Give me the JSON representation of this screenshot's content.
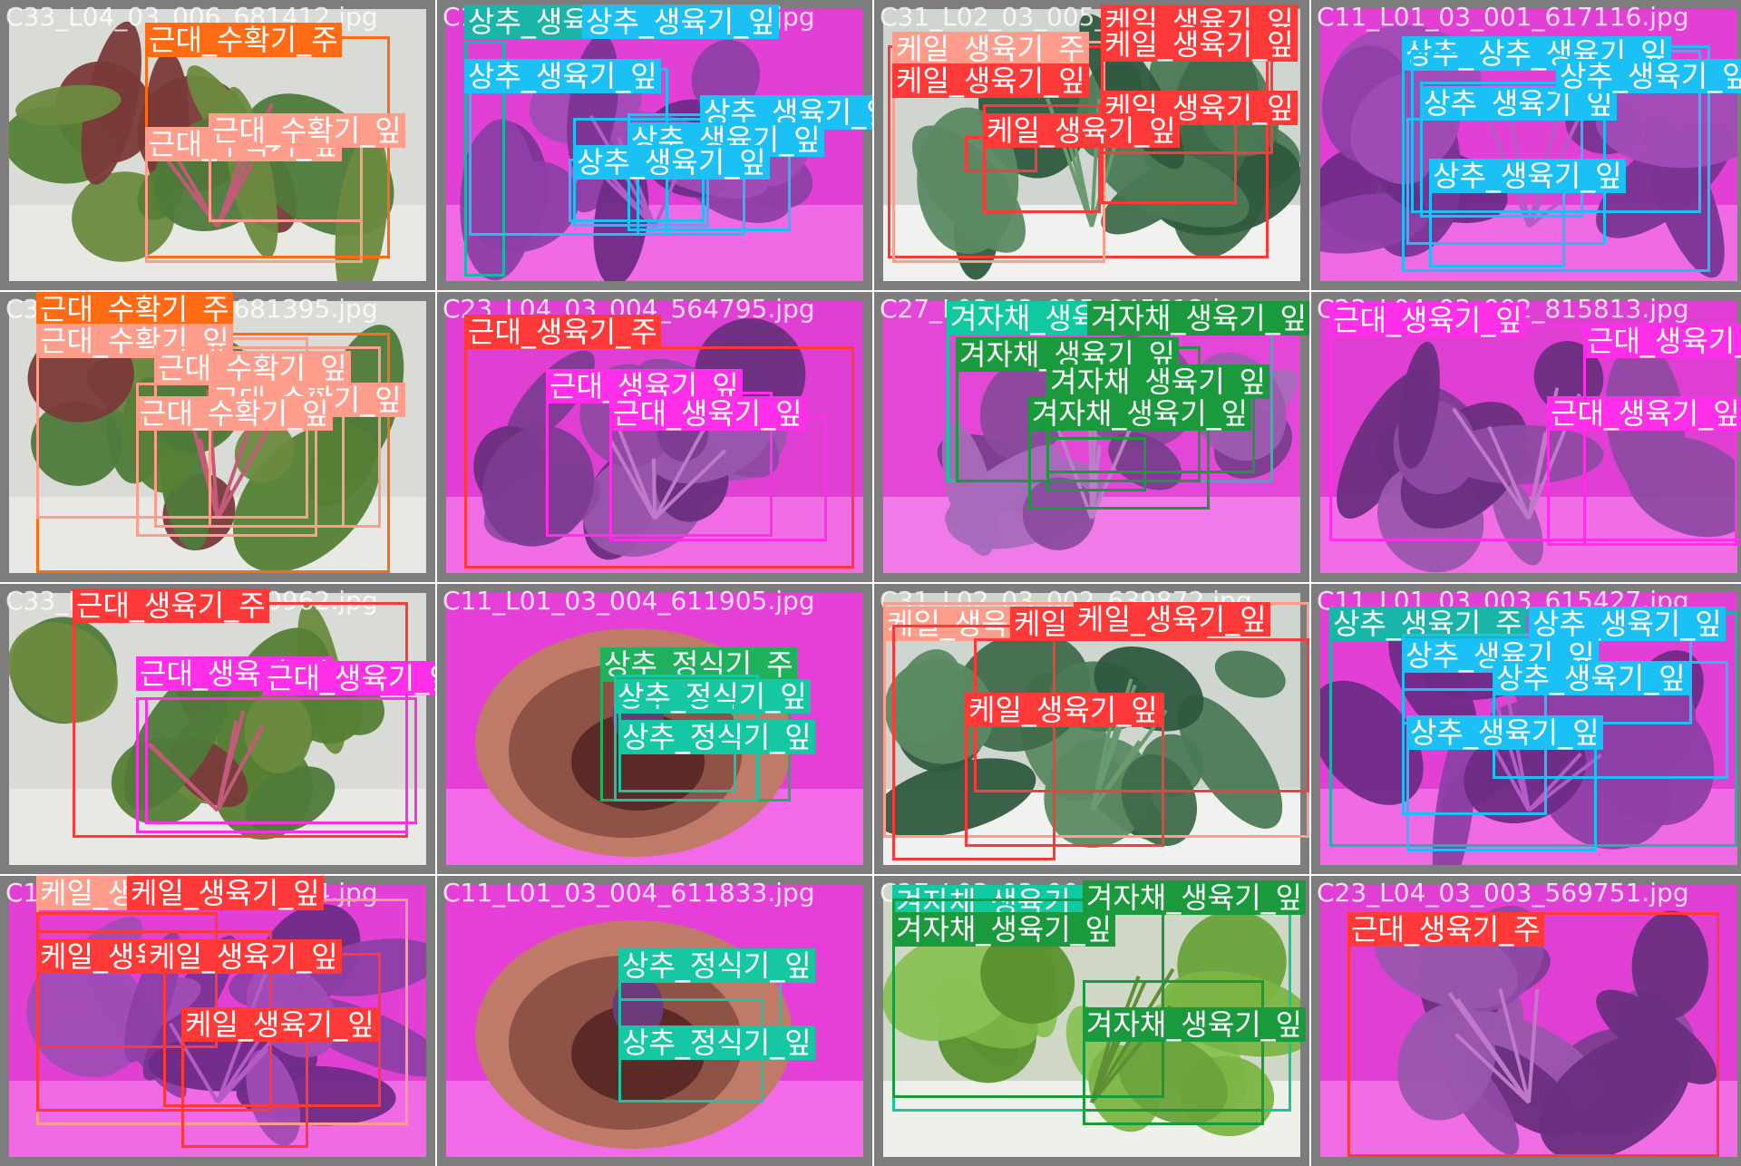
{
  "colors": {
    "근대_수확기_주": "#ff6a14",
    "근대_수확기_잎": "#ff9d8c",
    "근대_생육기_주": "#ff3838",
    "근대_생육기_잎": "#ff2ee8",
    "상추_생육기_주": "#1ab5a9",
    "상추_생육기_잎": "#1bc1f5",
    "상추_정식기_주": "#1fb15b",
    "상추_정식기_잎": "#16c7a3",
    "케일_생육기_주": "#ff9d8c",
    "케일_생육기_잎": "#ff3838",
    "겨자채_생육기_주": "#0fc9a0",
    "겨자채_생육기_잎": "#1a9a3c"
  },
  "tiles": [
    {
      "filename": "C33_L04_03_006_681412.jpg",
      "scene": "chard-real",
      "labels": [
        {
          "text": "근대_수확기_주",
          "cls": "근대_수확기_주"
        },
        {
          "text": "근대_수확기_잎",
          "cls": "근대_수확기_잎"
        },
        {
          "text": "근대_수확기_잎",
          "cls": "근대_수확기_잎"
        }
      ]
    },
    {
      "filename": "C11_L01_03_004_613111.jpg",
      "scene": "lettuce-pink",
      "labels": [
        {
          "text": "상추_생육기_주",
          "cls": "상추_생육기_주"
        },
        {
          "text": "상추_생육기_잎",
          "cls": "상추_생육기_잎"
        },
        {
          "text": "상추_생육기_잎",
          "cls": "상추_생육기_잎"
        },
        {
          "text": "상추_생육기_잎",
          "cls": "상추_생육기_잎"
        },
        {
          "text": "상추_생육기_잎",
          "cls": "상추_생육기_잎"
        },
        {
          "text": "상추_생육기_잎",
          "cls": "상추_생육기_잎"
        }
      ]
    },
    {
      "filename": "C31_L02_03_005_632214.jpg",
      "scene": "kale-real",
      "labels": [
        {
          "text": "케일_생육기_잎",
          "cls": "케일_생육기_잎"
        },
        {
          "text": "케일_생육기_주",
          "cls": "케일_생육기_주"
        },
        {
          "text": "케일_생육기_잎",
          "cls": "케일_생육기_잎"
        },
        {
          "text": "케일_생육기_잎",
          "cls": "케일_생육기_잎"
        },
        {
          "text": "케일_생육기_잎",
          "cls": "케일_생육기_잎"
        },
        {
          "text": "케일_생육기_잎",
          "cls": "케일_생육기_잎"
        }
      ]
    },
    {
      "filename": "C11_L01_03_001_617116.jpg",
      "scene": "lettuce-pink",
      "labels": [
        {
          "text": "상추_생육기_잎",
          "cls": "상추_생육기_잎"
        },
        {
          "text": "상추_생육기_잎",
          "cls": "상추_생육기_잎"
        },
        {
          "text": "상추_생육기_잎",
          "cls": "상추_생육기_잎"
        },
        {
          "text": "상추_생육기_잎",
          "cls": "상추_생육기_잎"
        },
        {
          "text": "상추_생육기_잎",
          "cls": "상추_생육기_잎"
        }
      ]
    },
    {
      "filename": "C33_L04_02_003_681395.jpg",
      "scene": "chard-real",
      "labels": [
        {
          "text": "근대_수확기_주",
          "cls": "근대_수확기_주"
        },
        {
          "text": "근대_수확기_잎",
          "cls": "근대_수확기_잎"
        },
        {
          "text": "근대_수확기_잎",
          "cls": "근대_수확기_잎"
        },
        {
          "text": "근대_수확기_잎",
          "cls": "근대_수확기_잎"
        },
        {
          "text": "근대_수확기_잎",
          "cls": "근대_수확기_잎"
        }
      ]
    },
    {
      "filename": "C23_L04_03_004_564795.jpg",
      "scene": "chard-pink",
      "labels": [
        {
          "text": "근대_생육기_주",
          "cls": "근대_생육기_주"
        },
        {
          "text": "근대_생육기_잎",
          "cls": "근대_생육기_잎"
        },
        {
          "text": "근대_생육기_잎",
          "cls": "근대_생육기_잎"
        }
      ]
    },
    {
      "filename": "C27_L03_03_005_845612.jpg",
      "scene": "mustard-pink",
      "labels": [
        {
          "text": "겨자채_생육기_주",
          "cls": "겨자채_생육기_주"
        },
        {
          "text": "겨자채_생육기_잎",
          "cls": "겨자채_생육기_잎"
        },
        {
          "text": "겨자채_생육기_잎",
          "cls": "겨자채_생육기_잎"
        },
        {
          "text": "겨자채_생육기_잎",
          "cls": "겨자채_생육기_잎"
        },
        {
          "text": "겨자채_생육기_잎",
          "cls": "겨자채_생육기_잎"
        }
      ]
    },
    {
      "filename": "C23_L04_03_002_815813.jpg",
      "scene": "chard-pink",
      "labels": [
        {
          "text": "근대_생육기_잎",
          "cls": "근대_생육기_잎"
        },
        {
          "text": "근대_생육기_잎",
          "cls": "근대_생육기_잎"
        },
        {
          "text": "근대_생육기_잎",
          "cls": "근대_생육기_잎"
        }
      ]
    },
    {
      "filename": "C33_L04_02_003_680962.jpg",
      "scene": "chard-real",
      "labels": [
        {
          "text": "근대_생육기_주",
          "cls": "근대_생육기_주"
        },
        {
          "text": "근대_생육기_잎",
          "cls": "근대_생육기_잎"
        },
        {
          "text": "근대_생육기_잎",
          "cls": "근대_생육기_잎"
        }
      ]
    },
    {
      "filename": "C11_L01_03_004_611905.jpg",
      "scene": "pot-pink",
      "labels": [
        {
          "text": "상추_정식기_주",
          "cls": "상추_정식기_주"
        },
        {
          "text": "상추_정식기_잎",
          "cls": "상추_정식기_잎"
        },
        {
          "text": "상추_정식기_잎",
          "cls": "상추_정식기_잎"
        }
      ]
    },
    {
      "filename": "C31_L02_03_002_639872.jpg",
      "scene": "kale-real",
      "labels": [
        {
          "text": "케일_생육기_주",
          "cls": "케일_생육기_주"
        },
        {
          "text": "케일_생육기_잎",
          "cls": "케일_생육기_잎"
        },
        {
          "text": "케일_생육기_잎",
          "cls": "케일_생육기_잎"
        },
        {
          "text": "케일_생육기_잎",
          "cls": "케일_생육기_잎"
        }
      ]
    },
    {
      "filename": "C11_L01_03_003_615427.jpg",
      "scene": "lettuce-pink",
      "labels": [
        {
          "text": "상추_생육기_주",
          "cls": "상추_생육기_주"
        },
        {
          "text": "상추_생육기_잎",
          "cls": "상추_생육기_잎"
        },
        {
          "text": "상추_생육기_잎",
          "cls": "상추_생육기_잎"
        },
        {
          "text": "상추_생육기_잎",
          "cls": "상추_생육기_잎"
        },
        {
          "text": "상추_생육기_잎",
          "cls": "상추_생육기_잎"
        }
      ]
    },
    {
      "filename": "C11_L02_03_004_611874.jpg",
      "scene": "lettuce-pink",
      "labels": [
        {
          "text": "케일_생육기_주",
          "cls": "케일_생육기_주"
        },
        {
          "text": "케일_생육기_잎",
          "cls": "케일_생육기_잎"
        },
        {
          "text": "케일_생육기_잎",
          "cls": "케일_생육기_잎"
        },
        {
          "text": "케일_생육기_잎",
          "cls": "케일_생육기_잎"
        },
        {
          "text": "케일_생육기_잎",
          "cls": "케일_생육기_잎"
        }
      ]
    },
    {
      "filename": "C11_L01_03_004_611833.jpg",
      "scene": "pot-pink",
      "labels": [
        {
          "text": "상추_정식기_잎",
          "cls": "상추_정식기_잎"
        },
        {
          "text": "상추_정식기_잎",
          "cls": "상추_정식기_잎"
        }
      ]
    },
    {
      "filename": "C27_L03_03_006_845659.jpg",
      "scene": "mustard-real",
      "labels": [
        {
          "text": "겨자채_생육기_주",
          "cls": "겨자채_생육기_주"
        },
        {
          "text": "겨자채_생육기_잎",
          "cls": "겨자채_생육기_잎"
        },
        {
          "text": "겨자채_생육기_잎",
          "cls": "겨자채_생육기_잎"
        },
        {
          "text": "겨자채_생육기_잎",
          "cls": "겨자채_생육기_잎"
        }
      ]
    },
    {
      "filename": "C23_L04_03_003_569751.jpg",
      "scene": "chard-pink",
      "labels": [
        {
          "text": "근대_생육기_주",
          "cls": "근대_생육기_주"
        }
      ]
    }
  ]
}
